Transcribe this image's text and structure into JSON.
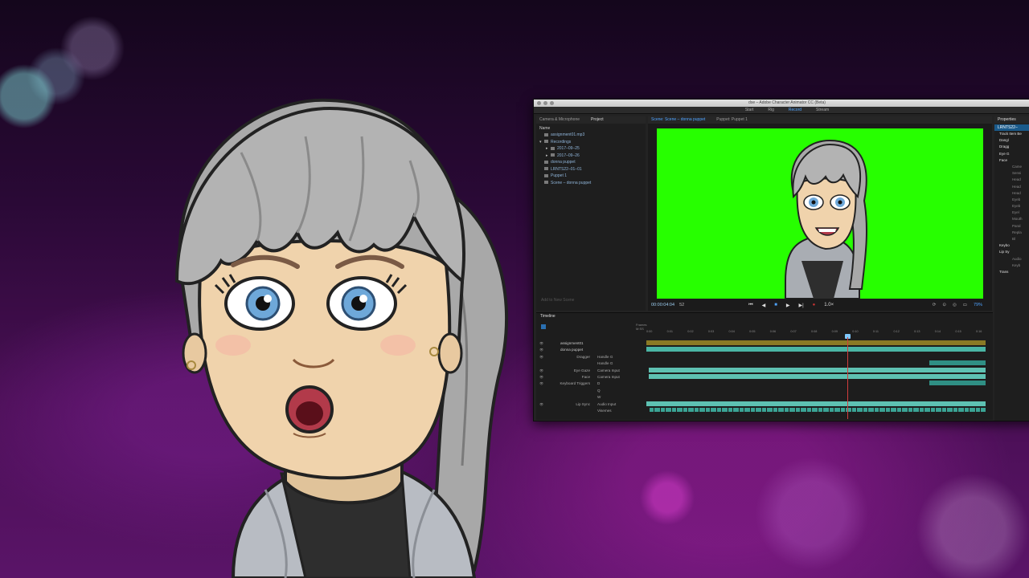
{
  "app": {
    "window_title": "dse – Adobe Character Animator CC (Beta)",
    "modes": [
      "Start",
      "Rig",
      "Record",
      "Stream"
    ],
    "active_mode": "Record"
  },
  "project_panel": {
    "tabs": [
      "Camera & Microphone",
      "Project"
    ],
    "column_header": "Name",
    "items": [
      {
        "label": "assignment01.mp3",
        "indent": 1
      },
      {
        "label": "Recordings",
        "indent": 0
      },
      {
        "label": "2017–09–25",
        "indent": 1
      },
      {
        "label": "2017–09–26",
        "indent": 1
      },
      {
        "label": "donna puppet",
        "indent": 1
      },
      {
        "label": "LRNTS22–01–01",
        "indent": 1
      },
      {
        "label": "Puppet 1",
        "indent": 1
      },
      {
        "label": "Scene – donna puppet",
        "indent": 1
      }
    ],
    "add_scene": "Add to New Scene"
  },
  "scene_panel": {
    "tabs": [
      "Scene: Scene – donna puppet",
      "Puppet: Puppet 1"
    ],
    "timecode": "00:00:04:04",
    "frame": "52",
    "fps": "12 fps",
    "speed": "1.0×",
    "zoom": "79%",
    "background_color": "#27ff00"
  },
  "properties_panel": {
    "title": "Properties",
    "selected": "LRNTS22–",
    "section": "Track Item Be",
    "rows": [
      {
        "label": "Dangl",
        "type": "grp"
      },
      {
        "label": "Dragg",
        "type": "grp"
      },
      {
        "label": "Eye G",
        "type": "grp"
      },
      {
        "label": "Face",
        "type": "grp"
      },
      {
        "label": "Came",
        "type": "sub"
      },
      {
        "label": "Sensi",
        "type": "sub"
      },
      {
        "label": "Head",
        "type": "sub"
      },
      {
        "label": "Head",
        "type": "sub"
      },
      {
        "label": "Head",
        "type": "sub"
      },
      {
        "label": "Eyeb",
        "type": "sub"
      },
      {
        "label": "Eyeb",
        "type": "sub"
      },
      {
        "label": "Eyel",
        "type": "sub"
      },
      {
        "label": "Mouth",
        "type": "sub"
      },
      {
        "label": "Paral",
        "type": "sub"
      },
      {
        "label": "Repla",
        "type": "sub"
      },
      {
        "label": "Bl",
        "type": "sub"
      },
      {
        "label": "Keybo",
        "type": "grp"
      },
      {
        "label": "Lip Sy",
        "type": "grp"
      },
      {
        "label": "Audio",
        "type": "sub"
      },
      {
        "label": "Keyb",
        "type": "sub"
      },
      {
        "label": "Trans",
        "type": "grp"
      }
    ]
  },
  "timeline": {
    "title": "Timeline",
    "ruler_label_frames": "Frames",
    "ruler_label_time": "M:SS",
    "ticks": [
      "0:00",
      "0:01",
      "0:02",
      "0:03",
      "0:04",
      "0:05",
      "0:06",
      "0:07",
      "0:08",
      "0:09",
      "0:10",
      "0:11",
      "0:12",
      "0:13",
      "0:14",
      "0:15",
      "0:16"
    ],
    "rows": [
      {
        "label": "",
        "value": "assignment01",
        "kind": "top"
      },
      {
        "label": "",
        "value": "donna puppet",
        "kind": "top"
      },
      {
        "label": "Dragger",
        "value": "Handle G"
      },
      {
        "label": "",
        "value": "Handle G"
      },
      {
        "label": "Eye Gaze",
        "value": "Camera Input"
      },
      {
        "label": "Face",
        "value": "Camera Input"
      },
      {
        "label": "Keyboard Triggers",
        "value": "D"
      },
      {
        "label": "",
        "value": "Q"
      },
      {
        "label": "",
        "value": "W"
      },
      {
        "label": "Lip Sync",
        "value": "Audio Input"
      },
      {
        "label": "",
        "value": "Visemes"
      }
    ]
  },
  "colors": {
    "accent": "#4fa3ff",
    "track_teal": "#4ab5a4",
    "track_olive": "#8a7a25",
    "playhead": "#d13d3d"
  }
}
